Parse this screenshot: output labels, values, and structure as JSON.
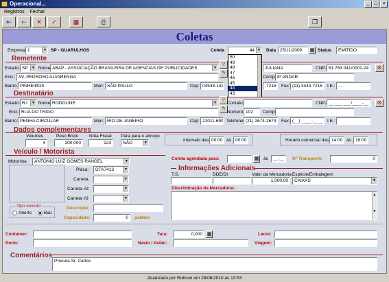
{
  "window": {
    "title": "Operacional...",
    "min": "_",
    "max": "□",
    "close": "×"
  },
  "menu": [
    "Registros",
    "Fechar"
  ],
  "banner": "Coletas",
  "header": {
    "empresa_label": "Empresa",
    "empresa_value": "1",
    "empresa_name": "SP - GUARULHOS",
    "coleta_label": "Coleta",
    "coleta_value": "44",
    "data_label": "Data",
    "data_value": "25/11/2009",
    "status_label": "Status",
    "status_value": "EMITIDO"
  },
  "coleta_options": [
    "50",
    "49",
    "48",
    "47",
    "46",
    "45",
    "44",
    "43"
  ],
  "coleta_selected": "44",
  "remetente": {
    "title": "Remetente",
    "estado_label": "Estado:",
    "estado": "SP",
    "nome_label": "Nome:",
    "nome": "ABAP - ASSOCIAÇÃO BRASILEIRA DE AGENCIAS DE PUBLICIDADES",
    "contato_partial": "JULIANA",
    "cnpj_label": "CNPJ:",
    "cnpj": "61.763.041/0001-24",
    "end_label": "End.:",
    "end": "AV. PEDROSO ALVARENGA",
    "compl_label": "Compl",
    "compl": "8º ANDAR",
    "bairro_label": "Bairro:",
    "bairro": "PINHEIROS",
    "mun_label": "Mun:",
    "mun": "SÃO PAULO",
    "cep_label": "Cep:",
    "cep": "04538-133",
    "tel_partial": "-7216",
    "fax_label": "Fax:",
    "fax": "(11) 3443-7216",
    "ie_label": "I.E.:",
    "ie": ". . ."
  },
  "destinatario": {
    "title": "Destinatário",
    "estado_label": "Estado:",
    "estado": "RJ",
    "nome_label": "Nome:",
    "nome": "RODOLINE",
    "contato_label": "Contato:",
    "contato": "",
    "cnpj_label": "CNPJ:",
    "cnpj": "__.___.___/____-__",
    "end_label": "End.:",
    "end": "RUA DO TRIGO",
    "numero_label": "Número:",
    "numero": "102",
    "compl_label": "Compl",
    "compl": "",
    "bairro_label": "Bairro:",
    "bairro": "PENHA CIRCULAR",
    "mun_label": "Mun:",
    "mun": "RIO DE JANEIRO",
    "cep_label": "Cep:",
    "cep": "21011-690",
    "tel_label": "Telefone:",
    "tel": "(21) 2674-2674",
    "fax_label": "Fax:",
    "fax": "(__) ____-____",
    "ie_label": "I.E.:",
    "ie": ""
  },
  "complementares": {
    "title": "Dados complementares",
    "volumes_label": "Volumes",
    "volumes": "4",
    "peso_label": "Peso Bruto",
    "peso": "200,000",
    "nf_label": "Nota Fiscal",
    "nf": "123",
    "almoco_label": "Para para o almoço",
    "almoco": "NÃO",
    "intervalo_label": "Intervalo das",
    "intervalo_de": "00:00",
    "as": "às",
    "intervalo_ate": "00:00",
    "horario_label": "Horário comercial das",
    "horario_de": "14:00",
    "horario_ate": "18:00"
  },
  "veiculo": {
    "title": "Veículo / Motorista",
    "motorista_label": "Motorista",
    "motorista": "ANTONIO LUIZ GOMES RANGEL",
    "placa_label": "Placa:",
    "placa": "DTA7413",
    "carreta_label": "Carreta:",
    "carreta2_label": "Carreta #2:",
    "carreta3_label": "Carreta #3",
    "tipo_label": "Tipo veículo:",
    "aberto": "Aberto",
    "bau": "Baú",
    "descricao_label": "Descrição:",
    "capacidade_label": "Capacidade:",
    "capacidade": "0",
    "paletes": "paletes"
  },
  "agendada": {
    "label": "Coleta agendada para:",
    "as": "às",
    "hora": "__:__",
    "transporte_label": "Nº Transporte:",
    "transporte": "0"
  },
  "adicionais": {
    "title": "Informações Adicionais",
    "ts_label": "T.S.",
    "dde_label": "DDE/DI",
    "valor_label": "Valor da Mercadoria",
    "valor": "1.000,00",
    "especie_label": "Espécie/Embalagem",
    "especie": "CAIXAS",
    "discriminacao_label": "Discriminação da Mercadoria:"
  },
  "rodape": {
    "container_label": "Container:",
    "tara_label": "Tara:",
    "tara": "0,000",
    "lacre_label": "Lacre:",
    "porto_label": "Porto:",
    "navio_label": "Navio / Avião:",
    "viagem_label": "Viagem:"
  },
  "comentarios": {
    "title": "Comentários",
    "text": "Procura Sr. Carlos"
  },
  "status_bar": "Atualizado por Robson em 28/06/2010 às 13:53"
}
